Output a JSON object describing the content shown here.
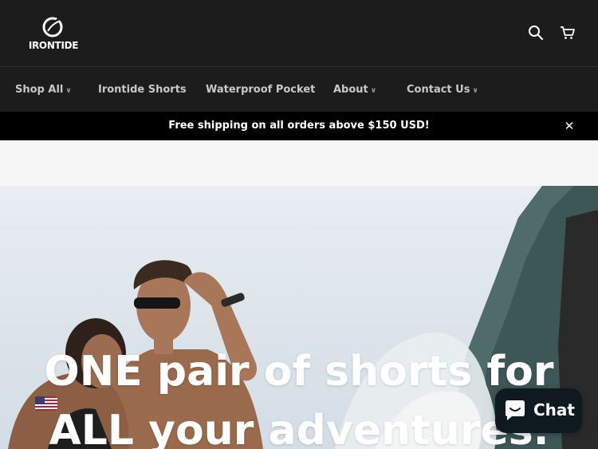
{
  "header": {
    "brand": "IRONTIDE",
    "search_icon": "search-icon",
    "cart_icon": "cart-icon"
  },
  "nav": {
    "items": [
      {
        "label": "Shop All",
        "has_dropdown": true
      },
      {
        "label": "Irontide Shorts",
        "has_dropdown": false
      },
      {
        "label": "Waterproof Pocket",
        "has_dropdown": false
      },
      {
        "label": "About",
        "has_dropdown": true
      },
      {
        "label": "Contact Us",
        "has_dropdown": true
      }
    ]
  },
  "announcement": {
    "text": "Free shipping on all orders above $150 USD!",
    "close_icon": "close-icon"
  },
  "hero": {
    "line1": "ONE pair of shorts for",
    "line2": "ALL your adventures."
  },
  "currency_selector": {
    "icon": "us-flag-icon"
  },
  "chat": {
    "label": "Chat",
    "icon": "chat-bubble-icon",
    "color": "#0e1a1f"
  },
  "colors": {
    "header_bg": "#1c1c1c",
    "announcement_bg": "#000000",
    "nav_text": "#c8c8c8"
  }
}
